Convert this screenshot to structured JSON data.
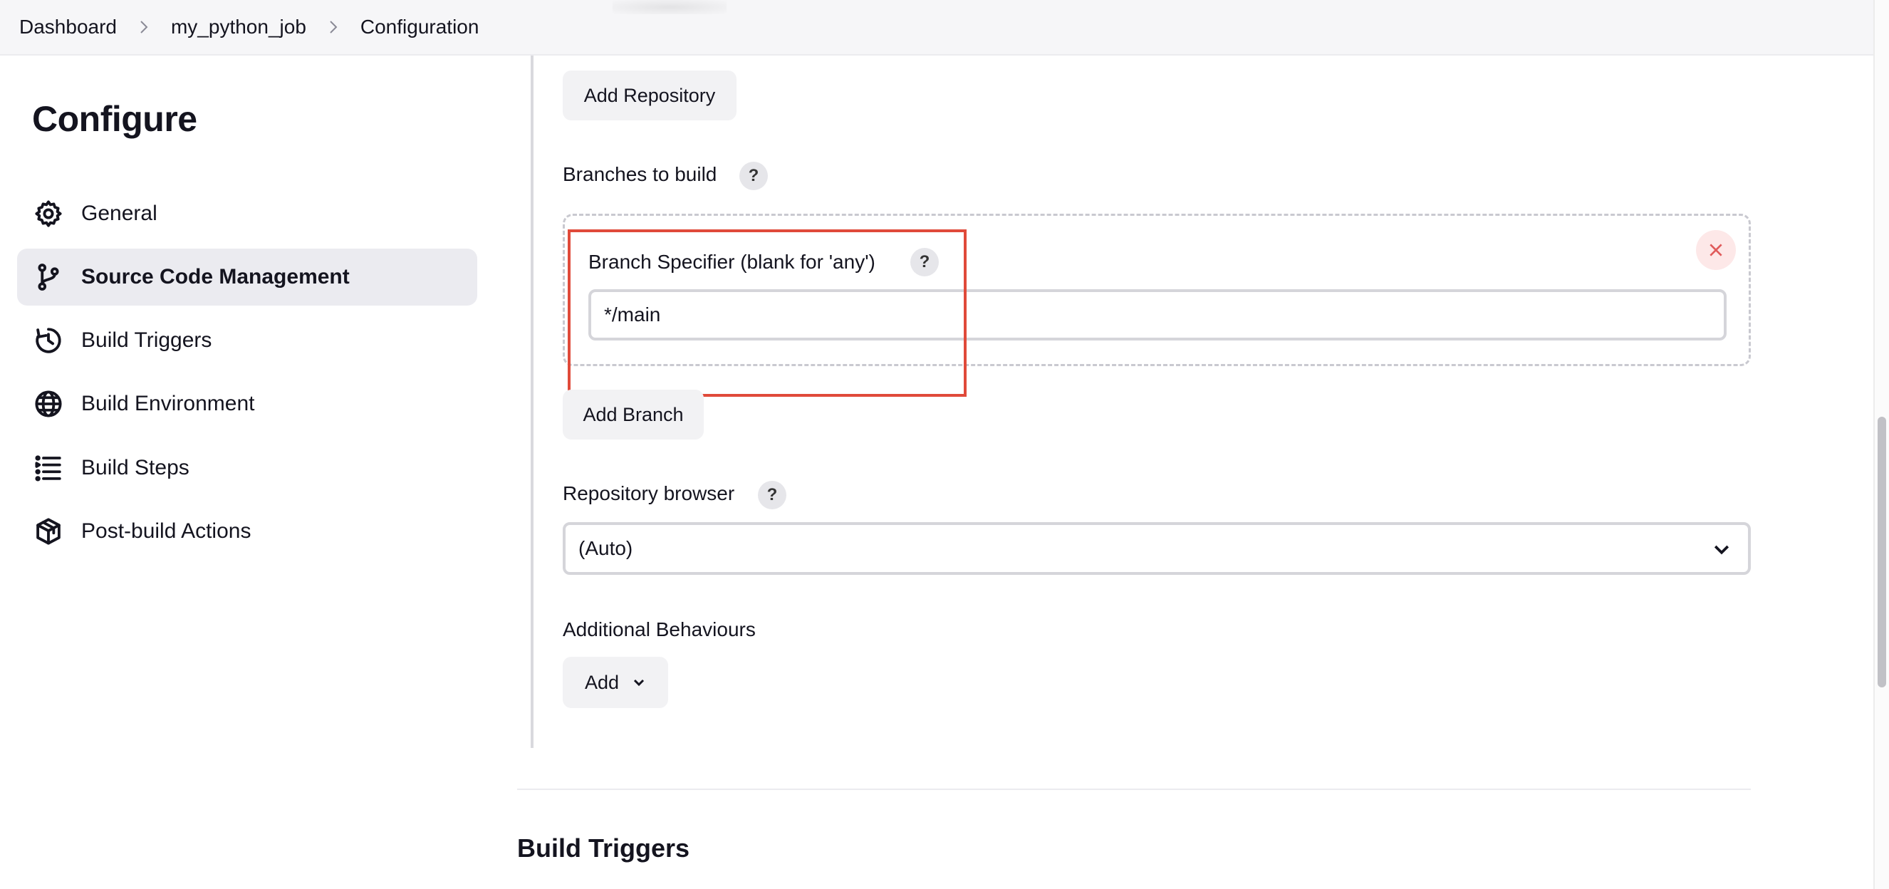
{
  "breadcrumb": {
    "items": [
      "Dashboard",
      "my_python_job",
      "Configuration"
    ]
  },
  "sidebar": {
    "title": "Configure",
    "items": [
      {
        "label": "General",
        "icon": "gear-icon"
      },
      {
        "label": "Source Code Management",
        "icon": "branch-icon",
        "active": true
      },
      {
        "label": "Build Triggers",
        "icon": "timer-icon"
      },
      {
        "label": "Build Environment",
        "icon": "globe-icon"
      },
      {
        "label": "Build Steps",
        "icon": "list-icon"
      },
      {
        "label": "Post-build Actions",
        "icon": "package-icon"
      }
    ]
  },
  "main": {
    "add_repository_label": "Add Repository",
    "branches_label": "Branches to build",
    "branch_specifier_label": "Branch Specifier (blank for 'any')",
    "branch_specifier_value": "*/main",
    "add_branch_label": "Add Branch",
    "repository_browser_label": "Repository browser",
    "repository_browser_value": "(Auto)",
    "additional_behaviours_label": "Additional Behaviours",
    "add_label": "Add",
    "help_glyph": "?",
    "next_section_title": "Build Triggers"
  },
  "colors": {
    "highlight": "#e04a3a",
    "active_nav_bg": "#ebebf0",
    "close_button": "#e05b5b"
  }
}
